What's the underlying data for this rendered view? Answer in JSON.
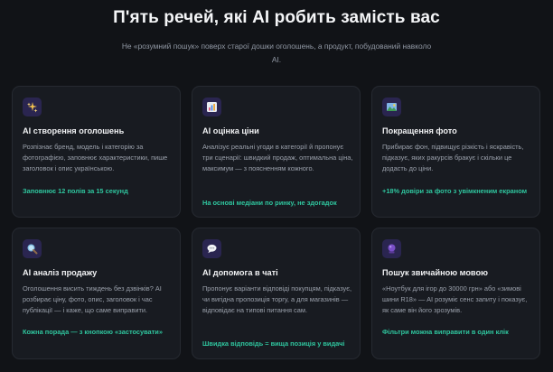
{
  "hero": {
    "title": "П'ять речей, які AI робить замість вас",
    "subtitle": "Не «розумний пошук» поверх старої дошки оголошень, а продукт, побудований навколо AI."
  },
  "cards": [
    {
      "icon": "sparkles-icon",
      "title": "AI створення оголошень",
      "desc": "Розпізнає бренд, модель і категорію за фотографією, заповнює характеристики, пише заголовок і опис українською.",
      "tag": "Заповнює 12 полів за 15 секунд"
    },
    {
      "icon": "bar-chart-icon",
      "title": "AI оцінка ціни",
      "desc": "Аналізує реальні угоди в категорії й пропонує три сценарії: швидкий продаж, оптимальна ціна, максимум — з поясненням кожного.",
      "tag": "На основі медіани по ринку, не здогадок"
    },
    {
      "icon": "picture-icon",
      "title": "Покращення фото",
      "desc": "Прибирає фон, підвищує різкість і яскравість, підказує, яких ракурсів бракує і скільки це додасть до ціни.",
      "tag": "+18% довіри за фото з увімкненим екраном"
    },
    {
      "icon": "magnifier-icon",
      "title": "AI аналіз продажу",
      "desc": "Оголошення висить тиждень без дзвінків? AI розбирає ціну, фото, опис, заголовок і час публікації — і каже, що саме виправити.",
      "tag": "Кожна порада — з кнопкою «застосувати»"
    },
    {
      "icon": "chat-bubble-icon",
      "title": "AI допомога в чаті",
      "desc": "Пропонує варіанти відповіді покупцям, підказує, чи вигідна пропозиція торгу, а для магазинів — відповідає на типові питання сам.",
      "tag": "Швидка відповідь = вища позиція у видачі"
    },
    {
      "icon": "crystal-ball-icon",
      "title": "Пошук звичайною мовою",
      "desc": "«Ноутбук для ігор до 30000 грн» або «зимові шини R18» — AI розуміє сенс запиту і показує, як саме він його зрозумів.",
      "tag": "Фільтри можна виправити в один клік"
    }
  ],
  "colors": {
    "background": "#111317",
    "card": "#181b21",
    "accent": "#2fc59e",
    "icon_bg": "#2a2550"
  }
}
